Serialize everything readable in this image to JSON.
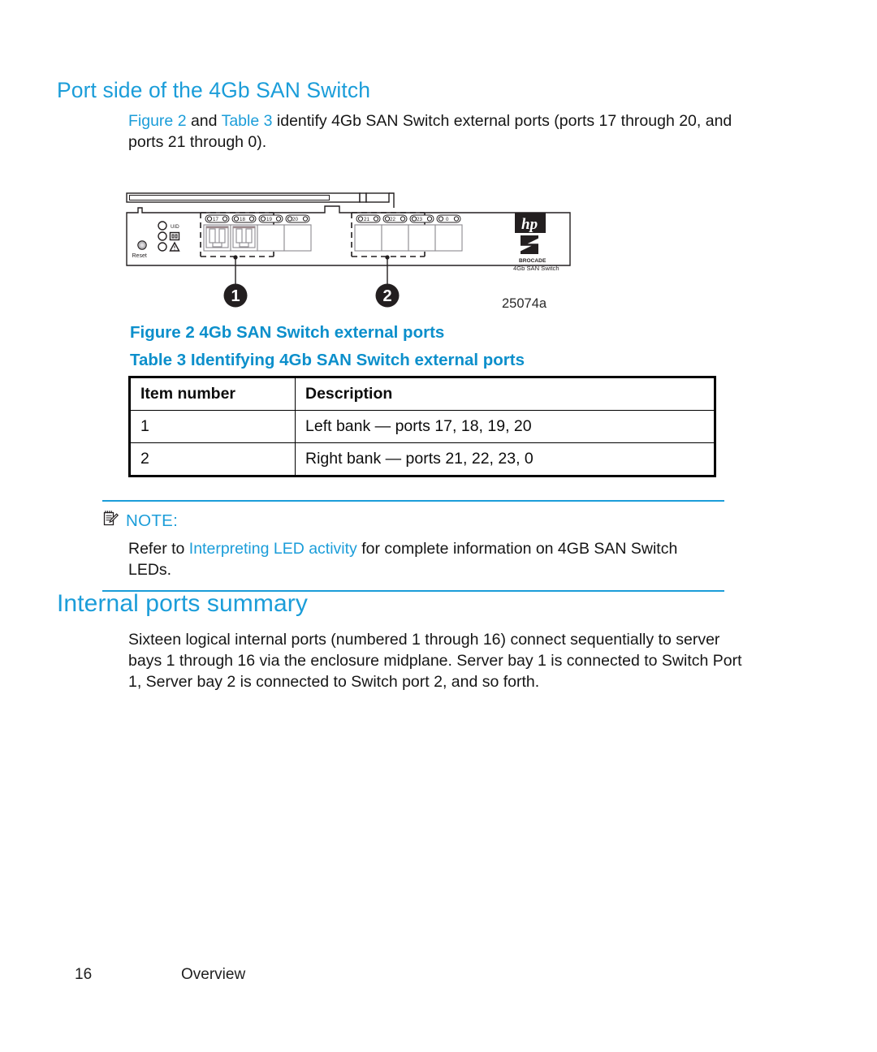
{
  "page": {
    "number": "16",
    "chapter": "Overview"
  },
  "sections": {
    "port_side": {
      "title": "Port side of the 4Gb SAN Switch",
      "intro": {
        "link_figure": "Figure 2",
        "mid_1": " and ",
        "link_table": "Table 3",
        "rest": " identify 4Gb SAN Switch external ports (ports 17 through 20, and ports 21 through 0)."
      }
    },
    "internal_ports": {
      "title": "Internal ports summary",
      "paragraph": "Sixteen logical internal ports (numbered 1 through 16) connect sequentially to server bays 1 through 16 via the enclosure midplane. Server bay 1 is connected to Switch Port 1, Server bay 2 is connected to Switch port 2, and so forth."
    }
  },
  "figure": {
    "caption": "Figure 2 4Gb SAN Switch external ports",
    "artwork_id": "25074a",
    "device": {
      "reset_label": "Reset",
      "leds": [
        {
          "name": "UID",
          "label": "UID"
        },
        {
          "name": "health",
          "label": ""
        },
        {
          "name": "fault",
          "label": ""
        }
      ],
      "left_bank_ports": [
        "17",
        "18",
        "19",
        "20"
      ],
      "right_bank_ports": [
        "21",
        "22",
        "23",
        "0"
      ],
      "brand_hp": "hp",
      "brand_brocade": "BROCADE",
      "brand_model": "4Gb SAN Switch"
    },
    "callouts": [
      {
        "number": "1"
      },
      {
        "number": "2"
      }
    ]
  },
  "table": {
    "caption": "Table 3 Identifying 4Gb SAN Switch external ports",
    "headers": [
      "Item number",
      "Description"
    ],
    "rows": [
      {
        "item": "1",
        "description": "Left bank — ports 17, 18, 19, 20"
      },
      {
        "item": "2",
        "description": "Right bank — ports 21, 22, 23, 0"
      }
    ]
  },
  "note": {
    "label": "NOTE:",
    "body_before": "Refer to ",
    "body_link": "Interpreting LED activity",
    "body_after": " for complete information on 4GB SAN Switch LEDs."
  },
  "colors": {
    "heading_blue": "#1B9DD9",
    "caption_blue": "#0C8FCB",
    "link_blue": "#1B9DD9",
    "text_black": "#161616"
  }
}
